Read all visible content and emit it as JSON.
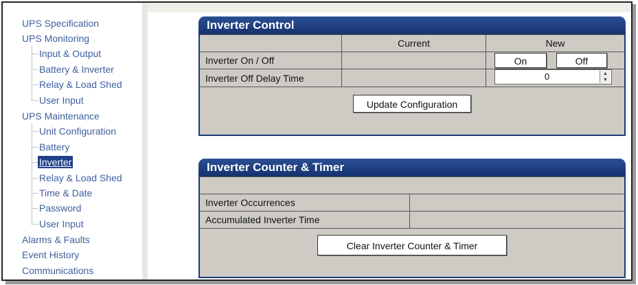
{
  "sidebar": {
    "items": [
      {
        "label": "UPS Specification"
      },
      {
        "label": "UPS Monitoring"
      },
      {
        "label": "Input & Output"
      },
      {
        "label": "Battery & Inverter"
      },
      {
        "label": "Relay & Load Shed"
      },
      {
        "label": "User Input"
      },
      {
        "label": "UPS Maintenance"
      },
      {
        "label": "Unit Configuration"
      },
      {
        "label": "Battery"
      },
      {
        "label": "Inverter"
      },
      {
        "label": "Relay & Load Shed"
      },
      {
        "label": "Time & Date"
      },
      {
        "label": "Password"
      },
      {
        "label": "User Input"
      },
      {
        "label": "Alarms & Faults"
      },
      {
        "label": "Event History"
      },
      {
        "label": "Communications"
      }
    ]
  },
  "inverter_control": {
    "title": "Inverter Control",
    "col_current": "Current",
    "col_new": "New",
    "rows": [
      {
        "label": "Inverter On / Off",
        "current": ""
      },
      {
        "label": "Inverter Off Delay Time",
        "current": ""
      }
    ],
    "on_label": "On",
    "off_label": "Off",
    "delay_value": "0",
    "update_label": "Update Configuration"
  },
  "counter_timer": {
    "title": "Inverter Counter & Timer",
    "rows": [
      {
        "label": "Inverter Occurrences",
        "value": ""
      },
      {
        "label": "Accumulated Inverter Time",
        "value": ""
      }
    ],
    "clear_label": "Clear Inverter Counter & Timer"
  },
  "colors": {
    "header": "#1f3f8a",
    "panel_bg": "#cdcbc4",
    "link": "#3d5f9e"
  }
}
